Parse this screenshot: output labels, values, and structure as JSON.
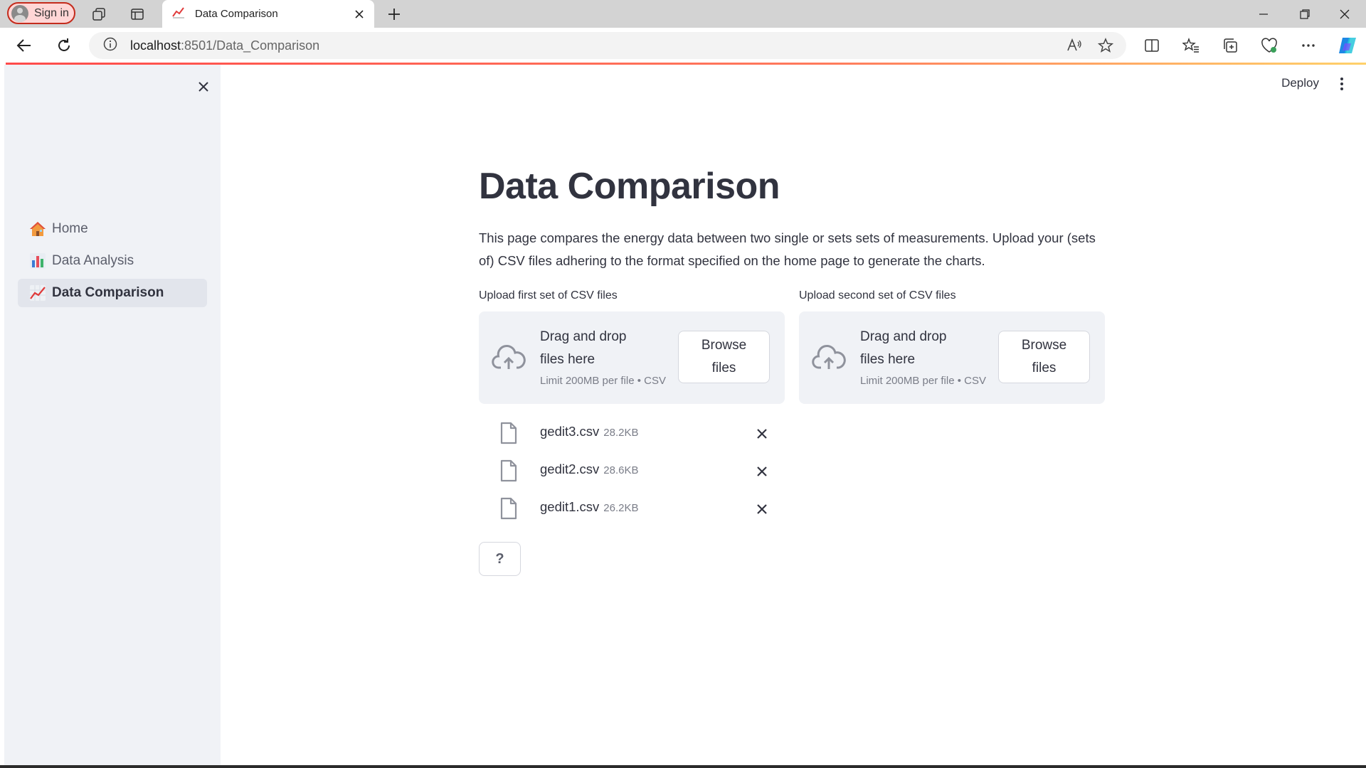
{
  "browser": {
    "signin_label": "Sign in",
    "tab_title": "Data Comparison",
    "url_host": "localhost",
    "url_rest": ":8501/Data_Comparison"
  },
  "header": {
    "deploy_label": "Deploy"
  },
  "sidebar": {
    "items": [
      {
        "label": "Home",
        "icon": "house-icon"
      },
      {
        "label": "Data Analysis",
        "icon": "bar-chart-icon"
      },
      {
        "label": "Data Comparison",
        "icon": "chart-increasing-icon",
        "active": true
      }
    ]
  },
  "main": {
    "title": "Data Comparison",
    "intro": "This page compares the energy data between two single or sets sets of measurements. Upload your (sets of) CSV files adhering to the format specified on the home page to generate the charts.",
    "uploaders": [
      {
        "label": "Upload first set of CSV files",
        "drop_text": "Drag and drop files here",
        "limit_text": "Limit 200MB per file • CSV",
        "browse_label": "Browse files"
      },
      {
        "label": "Upload second set of CSV files",
        "drop_text": "Drag and drop files here",
        "limit_text": "Limit 200MB per file • CSV",
        "browse_label": "Browse files"
      }
    ],
    "files": [
      {
        "name": "gedit3.csv",
        "size": "28.2KB"
      },
      {
        "name": "gedit2.csv",
        "size": "28.6KB"
      },
      {
        "name": "gedit1.csv",
        "size": "26.2KB"
      }
    ],
    "help_label": "?"
  },
  "colors": {
    "accent": "#ff4b4b",
    "sidebar_bg": "#f0f2f6",
    "text": "#31333f"
  }
}
